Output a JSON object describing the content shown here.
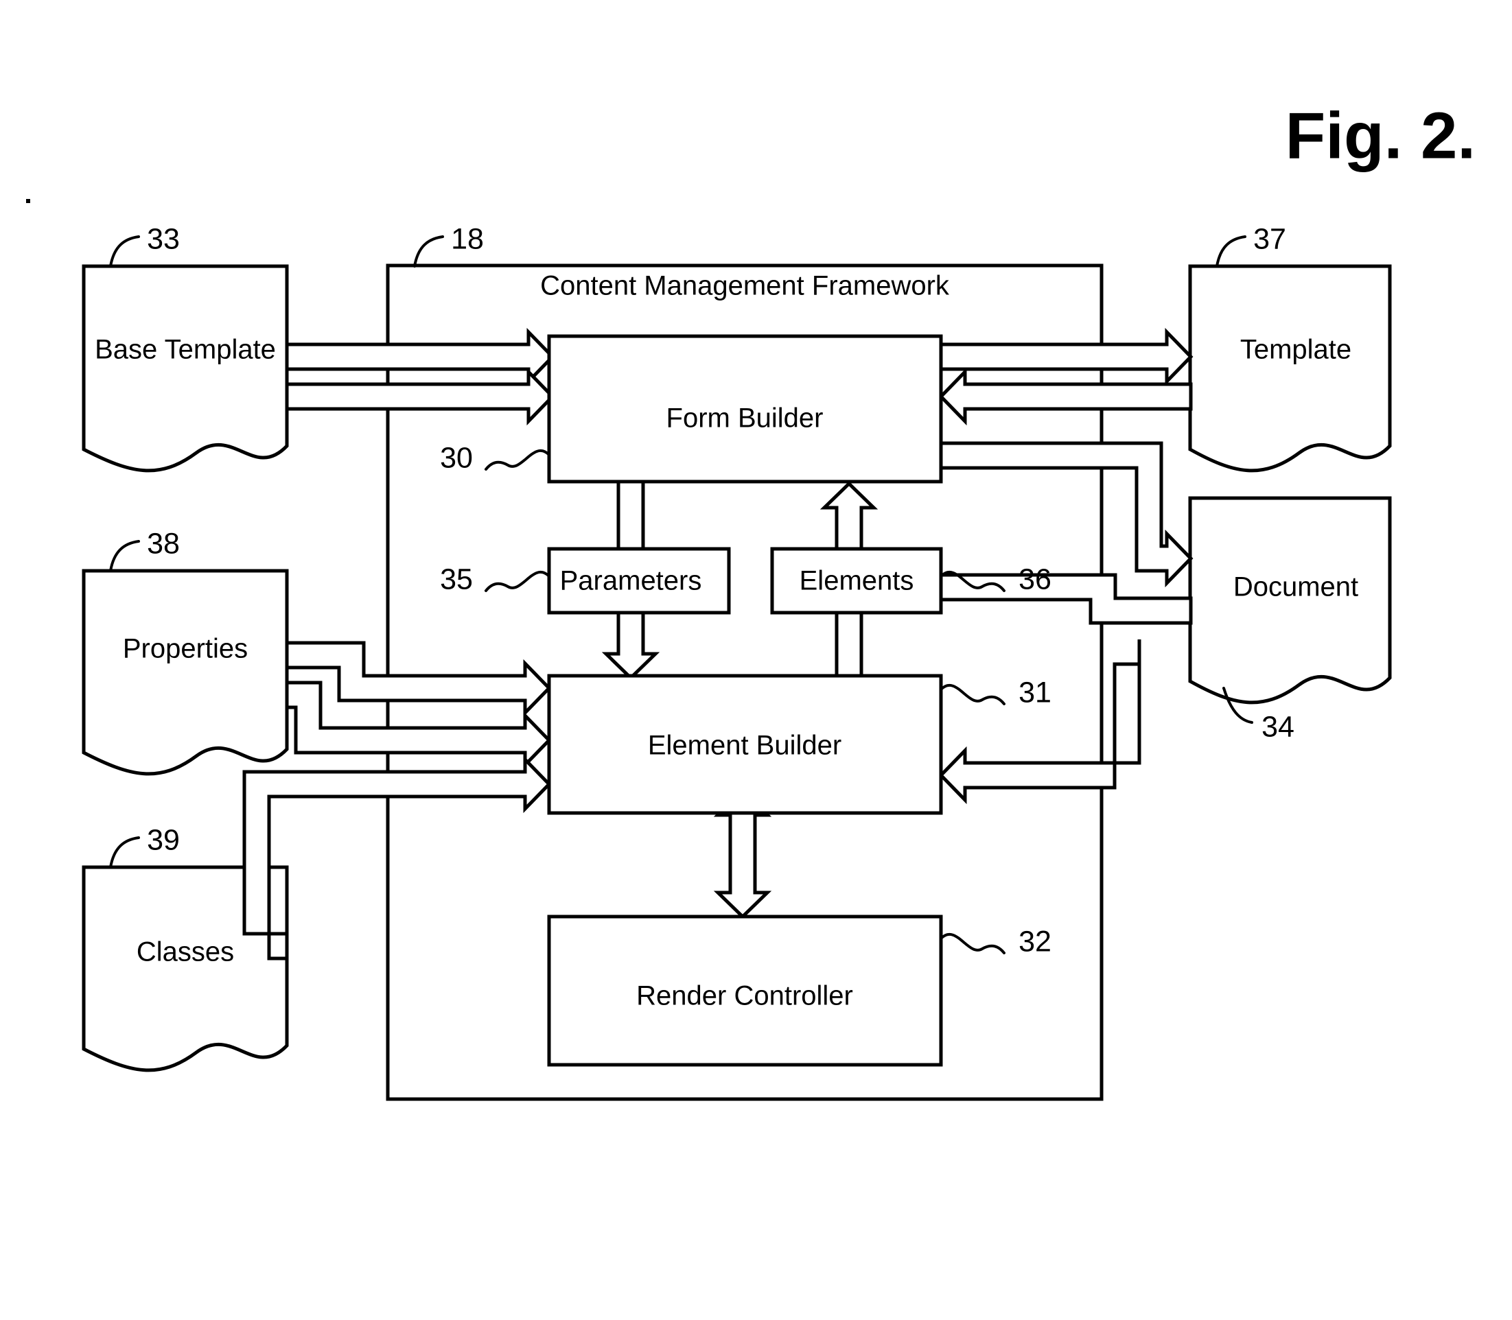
{
  "figure": {
    "title": "Fig. 2."
  },
  "framework": {
    "label": "Content Management Framework",
    "ref": "18"
  },
  "blocks": [
    {
      "id": "form-builder",
      "label": "Form Builder",
      "ref": "30"
    },
    {
      "id": "element-builder",
      "label": "Element Builder",
      "ref": "31"
    },
    {
      "id": "render-controller",
      "label": "Render Controller",
      "ref": "32"
    },
    {
      "id": "parameters",
      "label": "Parameters",
      "ref": "35"
    },
    {
      "id": "elements",
      "label": "Elements",
      "ref": "36"
    }
  ],
  "documents": [
    {
      "id": "base-template",
      "label": "Base Template",
      "ref": "33"
    },
    {
      "id": "properties",
      "label": "Properties",
      "ref": "38"
    },
    {
      "id": "classes",
      "label": "Classes",
      "ref": "39"
    },
    {
      "id": "template",
      "label": "Template",
      "ref": "37"
    },
    {
      "id": "document",
      "label": "Document",
      "ref": "34"
    }
  ],
  "colors": {
    "ink": "#000000",
    "paper": "#ffffff"
  },
  "chart_data": {
    "type": "diagram",
    "title": "Fig. 2. - Content Management Framework block diagram",
    "nodes": [
      {
        "ref": "18",
        "name": "Content Management Framework",
        "kind": "container"
      },
      {
        "ref": "30",
        "name": "Form Builder",
        "kind": "process"
      },
      {
        "ref": "31",
        "name": "Element Builder",
        "kind": "process"
      },
      {
        "ref": "32",
        "name": "Render Controller",
        "kind": "process"
      },
      {
        "ref": "35",
        "name": "Parameters",
        "kind": "data"
      },
      {
        "ref": "36",
        "name": "Elements",
        "kind": "data"
      },
      {
        "ref": "33",
        "name": "Base Template",
        "kind": "document"
      },
      {
        "ref": "37",
        "name": "Template",
        "kind": "document"
      },
      {
        "ref": "38",
        "name": "Properties",
        "kind": "document"
      },
      {
        "ref": "39",
        "name": "Classes",
        "kind": "document"
      },
      {
        "ref": "34",
        "name": "Document",
        "kind": "document"
      }
    ],
    "edges": [
      {
        "from": "Base Template",
        "to": "Form Builder",
        "arrow": "single",
        "count": 2
      },
      {
        "from": "Form Builder",
        "to": "Template",
        "arrow": "double",
        "count": 2
      },
      {
        "from": "Form Builder",
        "to": "Parameters",
        "arrow": "none"
      },
      {
        "from": "Elements",
        "to": "Form Builder",
        "arrow": "single"
      },
      {
        "from": "Parameters",
        "to": "Element Builder",
        "arrow": "single"
      },
      {
        "from": "Elements",
        "to": "Element Builder",
        "arrow": "none"
      },
      {
        "from": "Properties",
        "to": "Element Builder",
        "arrow": "single",
        "count": 2
      },
      {
        "from": "Classes",
        "to": "Element Builder",
        "arrow": "single"
      },
      {
        "from": "Form Builder",
        "to": "Document",
        "arrow": "single"
      },
      {
        "from": "Element Builder",
        "to": "Document",
        "arrow": "single"
      },
      {
        "from": "Document",
        "to": "Element Builder",
        "arrow": "single"
      },
      {
        "from": "Element Builder",
        "to": "Render Controller",
        "arrow": "double"
      }
    ]
  }
}
